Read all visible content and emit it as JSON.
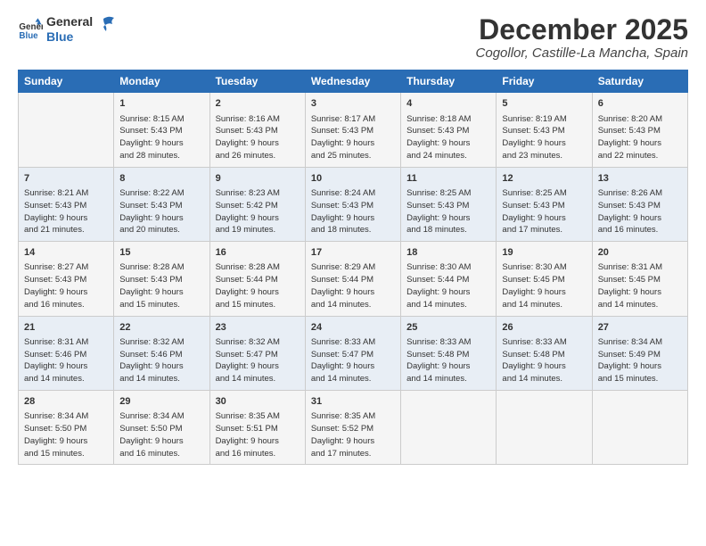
{
  "header": {
    "logo_line1": "General",
    "logo_line2": "Blue",
    "title": "December 2025",
    "subtitle": "Cogollor, Castille-La Mancha, Spain"
  },
  "weekdays": [
    "Sunday",
    "Monday",
    "Tuesday",
    "Wednesday",
    "Thursday",
    "Friday",
    "Saturday"
  ],
  "weeks": [
    [
      {
        "day": "",
        "info": ""
      },
      {
        "day": "1",
        "info": "Sunrise: 8:15 AM\nSunset: 5:43 PM\nDaylight: 9 hours\nand 28 minutes."
      },
      {
        "day": "2",
        "info": "Sunrise: 8:16 AM\nSunset: 5:43 PM\nDaylight: 9 hours\nand 26 minutes."
      },
      {
        "day": "3",
        "info": "Sunrise: 8:17 AM\nSunset: 5:43 PM\nDaylight: 9 hours\nand 25 minutes."
      },
      {
        "day": "4",
        "info": "Sunrise: 8:18 AM\nSunset: 5:43 PM\nDaylight: 9 hours\nand 24 minutes."
      },
      {
        "day": "5",
        "info": "Sunrise: 8:19 AM\nSunset: 5:43 PM\nDaylight: 9 hours\nand 23 minutes."
      },
      {
        "day": "6",
        "info": "Sunrise: 8:20 AM\nSunset: 5:43 PM\nDaylight: 9 hours\nand 22 minutes."
      }
    ],
    [
      {
        "day": "7",
        "info": "Sunrise: 8:21 AM\nSunset: 5:43 PM\nDaylight: 9 hours\nand 21 minutes."
      },
      {
        "day": "8",
        "info": "Sunrise: 8:22 AM\nSunset: 5:43 PM\nDaylight: 9 hours\nand 20 minutes."
      },
      {
        "day": "9",
        "info": "Sunrise: 8:23 AM\nSunset: 5:42 PM\nDaylight: 9 hours\nand 19 minutes."
      },
      {
        "day": "10",
        "info": "Sunrise: 8:24 AM\nSunset: 5:43 PM\nDaylight: 9 hours\nand 18 minutes."
      },
      {
        "day": "11",
        "info": "Sunrise: 8:25 AM\nSunset: 5:43 PM\nDaylight: 9 hours\nand 18 minutes."
      },
      {
        "day": "12",
        "info": "Sunrise: 8:25 AM\nSunset: 5:43 PM\nDaylight: 9 hours\nand 17 minutes."
      },
      {
        "day": "13",
        "info": "Sunrise: 8:26 AM\nSunset: 5:43 PM\nDaylight: 9 hours\nand 16 minutes."
      }
    ],
    [
      {
        "day": "14",
        "info": "Sunrise: 8:27 AM\nSunset: 5:43 PM\nDaylight: 9 hours\nand 16 minutes."
      },
      {
        "day": "15",
        "info": "Sunrise: 8:28 AM\nSunset: 5:43 PM\nDaylight: 9 hours\nand 15 minutes."
      },
      {
        "day": "16",
        "info": "Sunrise: 8:28 AM\nSunset: 5:44 PM\nDaylight: 9 hours\nand 15 minutes."
      },
      {
        "day": "17",
        "info": "Sunrise: 8:29 AM\nSunset: 5:44 PM\nDaylight: 9 hours\nand 14 minutes."
      },
      {
        "day": "18",
        "info": "Sunrise: 8:30 AM\nSunset: 5:44 PM\nDaylight: 9 hours\nand 14 minutes."
      },
      {
        "day": "19",
        "info": "Sunrise: 8:30 AM\nSunset: 5:45 PM\nDaylight: 9 hours\nand 14 minutes."
      },
      {
        "day": "20",
        "info": "Sunrise: 8:31 AM\nSunset: 5:45 PM\nDaylight: 9 hours\nand 14 minutes."
      }
    ],
    [
      {
        "day": "21",
        "info": "Sunrise: 8:31 AM\nSunset: 5:46 PM\nDaylight: 9 hours\nand 14 minutes."
      },
      {
        "day": "22",
        "info": "Sunrise: 8:32 AM\nSunset: 5:46 PM\nDaylight: 9 hours\nand 14 minutes."
      },
      {
        "day": "23",
        "info": "Sunrise: 8:32 AM\nSunset: 5:47 PM\nDaylight: 9 hours\nand 14 minutes."
      },
      {
        "day": "24",
        "info": "Sunrise: 8:33 AM\nSunset: 5:47 PM\nDaylight: 9 hours\nand 14 minutes."
      },
      {
        "day": "25",
        "info": "Sunrise: 8:33 AM\nSunset: 5:48 PM\nDaylight: 9 hours\nand 14 minutes."
      },
      {
        "day": "26",
        "info": "Sunrise: 8:33 AM\nSunset: 5:48 PM\nDaylight: 9 hours\nand 14 minutes."
      },
      {
        "day": "27",
        "info": "Sunrise: 8:34 AM\nSunset: 5:49 PM\nDaylight: 9 hours\nand 15 minutes."
      }
    ],
    [
      {
        "day": "28",
        "info": "Sunrise: 8:34 AM\nSunset: 5:50 PM\nDaylight: 9 hours\nand 15 minutes."
      },
      {
        "day": "29",
        "info": "Sunrise: 8:34 AM\nSunset: 5:50 PM\nDaylight: 9 hours\nand 16 minutes."
      },
      {
        "day": "30",
        "info": "Sunrise: 8:35 AM\nSunset: 5:51 PM\nDaylight: 9 hours\nand 16 minutes."
      },
      {
        "day": "31",
        "info": "Sunrise: 8:35 AM\nSunset: 5:52 PM\nDaylight: 9 hours\nand 17 minutes."
      },
      {
        "day": "",
        "info": ""
      },
      {
        "day": "",
        "info": ""
      },
      {
        "day": "",
        "info": ""
      }
    ]
  ]
}
